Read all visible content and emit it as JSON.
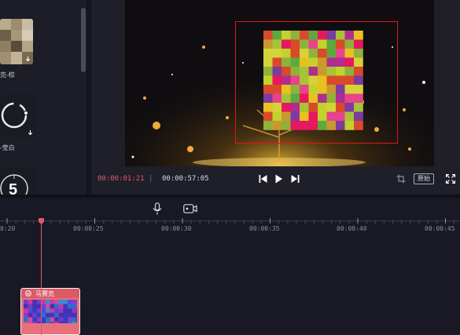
{
  "left_panel": {
    "items": [
      {
        "label": "克-棕",
        "icon": "download-icon"
      },
      {
        "label": "-莹白",
        "icon": "download-icon"
      },
      {
        "label": "5"
      }
    ]
  },
  "player": {
    "current_time": "00:00:01:21",
    "separator": "|",
    "total_time": "00:00:57:05",
    "ratio_label": "原始",
    "icons": [
      "prev-frame-icon",
      "play-icon",
      "next-frame-icon",
      "crop-icon",
      "fullscreen-icon"
    ]
  },
  "timeline": {
    "ruler_labels": [
      "0:20",
      "00:00:25",
      "00:00:30",
      "00:00:35",
      "00:00:40",
      "00:00:45"
    ],
    "clip": {
      "name": "马赛克"
    },
    "icons": [
      "microphone-icon",
      "camera-icon"
    ]
  },
  "colors": {
    "accent": "#e0596b",
    "selection_box": "#e5131c",
    "clip": "#e8707a",
    "background": "#161720"
  }
}
